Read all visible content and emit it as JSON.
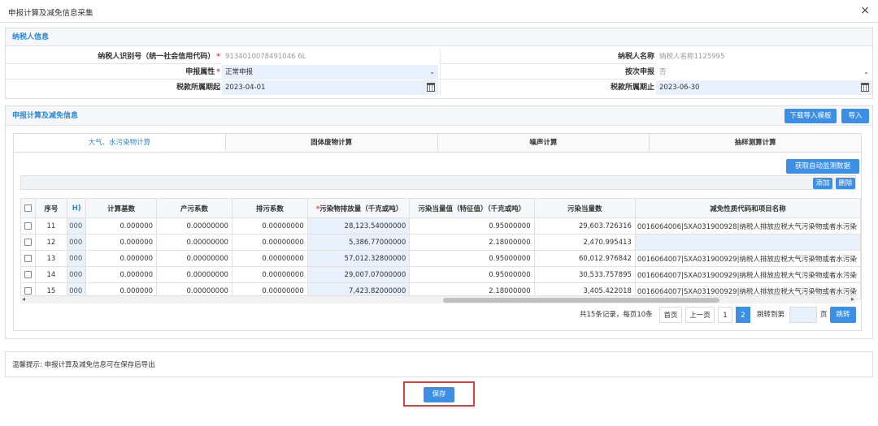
{
  "dialog": {
    "title": "申报计算及减免信息采集",
    "close_glyph": "×"
  },
  "taxpayer": {
    "section_title": "纳税人信息",
    "id_label": "纳税人识别号（统一社会信用代码）",
    "id_value": "9134010078491046 6L",
    "name_label": "纳税人名称",
    "name_value": "纳税人名称1125995",
    "attr_label": "申报属性",
    "attr_value": "正常申报",
    "per_label": "按次申报",
    "per_value": "否",
    "start_label": "税款所属期起",
    "start_value": "2023-04-01",
    "end_label": "税款所属期止",
    "end_value": "2023-06-30",
    "required_mark": "*"
  },
  "calc": {
    "section_title": "申报计算及减免信息",
    "download_template": "下载导入模板",
    "import": "导入",
    "tabs": [
      "大气、水污染物计算",
      "固体废物计算",
      "噪声计算",
      "抽样测算计算"
    ],
    "fetch_monitor": "获取自动监测数据",
    "add": "添加",
    "delete": "删除",
    "columns": {
      "seq": "序号",
      "partial": "H)",
      "calc_base": "计算基数",
      "prod_coef": "产污系数",
      "emit_coef": "排污系数",
      "emission": "污染物排放量（千克或吨）",
      "equiv_value": "污染当量值（特征值）（千克或吨）",
      "equiv_count": "污染当量数",
      "reduction": "减免性质代码和项目名称"
    },
    "rows": [
      {
        "seq": "11",
        "partial": "000",
        "calc_base": "0.000000",
        "prod_coef": "0.00000000",
        "emit_coef": "0.00000000",
        "emission": "28,123.54000000",
        "equiv_value": "0.95000000",
        "equiv_count": "29,603.726316",
        "reduction": "0016064006|SXA031900928|纳税人排放应税大气污染物或者水污染"
      },
      {
        "seq": "12",
        "partial": "000",
        "calc_base": "0.000000",
        "prod_coef": "0.00000000",
        "emit_coef": "0.00000000",
        "emission": "5,386.77000000",
        "equiv_value": "2.18000000",
        "equiv_count": "2,470.995413",
        "reduction": ""
      },
      {
        "seq": "13",
        "partial": "000",
        "calc_base": "0.000000",
        "prod_coef": "0.00000000",
        "emit_coef": "0.00000000",
        "emission": "57,012.32800000",
        "equiv_value": "0.95000000",
        "equiv_count": "60,012.976842",
        "reduction": "0016064007|SXA031900929|纳税人排放应税大气污染物或者水污染"
      },
      {
        "seq": "14",
        "partial": "000",
        "calc_base": "0.000000",
        "prod_coef": "0.00000000",
        "emit_coef": "0.00000000",
        "emission": "29,007.07000000",
        "equiv_value": "0.95000000",
        "equiv_count": "30,533.757895",
        "reduction": "0016064007|SXA031900929|纳税人排放应税大气污染物或者水污染"
      },
      {
        "seq": "15",
        "partial": "000",
        "calc_base": "0.000000",
        "prod_coef": "0.00000000",
        "emit_coef": "0.00000000",
        "emission": "7,423.82000000",
        "equiv_value": "2.18000000",
        "equiv_count": "3,405.422018",
        "reduction": "0016064007|SXA031900929|纳税人排放应税大气污染物或者水污染"
      }
    ],
    "pager": {
      "summary": "共15条记录，每页10条",
      "first": "首页",
      "prev": "上一页",
      "page1": "1",
      "page2": "2",
      "jump_label": "跳转到第",
      "page_unit": "页",
      "jump_btn": "跳转"
    }
  },
  "hint": "温馨提示: 申报计算及减免信息可在保存后导出",
  "save": "保存",
  "colors": {
    "accent": "#3d8fe6",
    "highlight": "#e03c3c",
    "cell_blue": "#e8f1fb"
  }
}
